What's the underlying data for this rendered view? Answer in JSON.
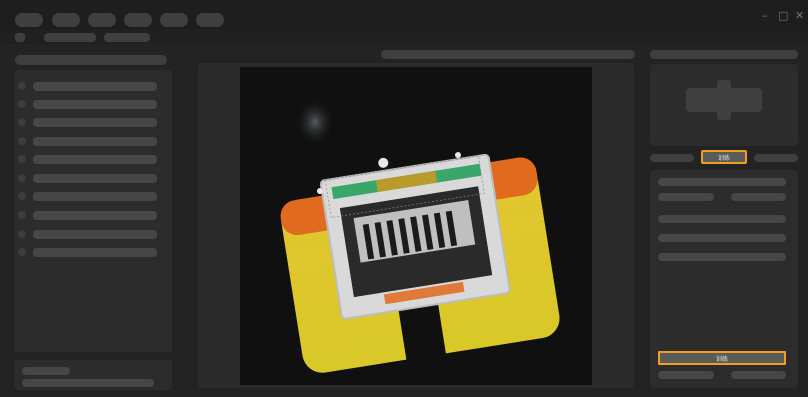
{
  "window": {
    "minimize_glyph": "–",
    "maximize_glyph": "□",
    "close_glyph": "✕"
  },
  "controls": {
    "train_button_label": "训练",
    "train_button_bottom_label": "训练"
  },
  "colors": {
    "accent": "#f0a01e",
    "background": "#232323",
    "panel": "#2c2c2c"
  }
}
